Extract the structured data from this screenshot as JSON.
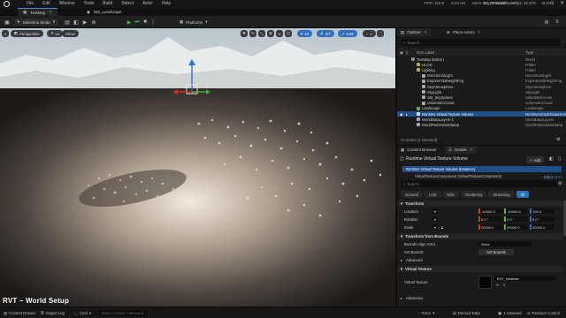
{
  "titlebar": {
    "menu": [
      "File",
      "Edit",
      "Window",
      "Tools",
      "Build",
      "Select",
      "Actor",
      "Help"
    ],
    "stats": [
      "FPS: 119.9",
      "8.34 ms",
      "Mem: 3,548.80 MB",
      "Objs: 42,878",
      "0 Errs"
    ],
    "project": "SC_TerrainShader"
  },
  "tabs": [
    {
      "label": "TestMap"
    },
    {
      "label": "NM_Landscape"
    }
  ],
  "toolbar": {
    "mode": "Selection Mode",
    "platforms": "Platforms"
  },
  "viewport": {
    "perspective": "Perspective",
    "lit": "Lit",
    "show": "Show",
    "snap_grid": "10",
    "snap_rotate": "10°",
    "snap_scale": "0.25",
    "camera_speed": "1"
  },
  "outliner": {
    "tab": "Outliner",
    "tab2": "Place Actors",
    "search_placeholder": "Search...",
    "col_label": "Item Label",
    "col_type": "Type",
    "rows": [
      {
        "label": "TestMap (Editor)",
        "type": "World"
      },
      {
        "label": "HLOD",
        "type": "Folder"
      },
      {
        "label": "Lighting",
        "type": "Folder"
      },
      {
        "label": "DirectionalLight",
        "type": "DirectionalLight"
      },
      {
        "label": "ExponentialHeightFog",
        "type": "ExponentialHeightFog"
      },
      {
        "label": "SkyAtmosphere",
        "type": "SkyAtmosphere"
      },
      {
        "label": "SkyLight",
        "type": "SkyLight"
      },
      {
        "label": "SM_SkySphere",
        "type": "StaticMeshActor"
      },
      {
        "label": "VolumetricCloud",
        "type": "VolumetricCloud"
      },
      {
        "label": "Landscape",
        "type": "Landscape"
      },
      {
        "label": "Runtime Virtual Texture Volume",
        "type": "RuntimeVirtualTextureVolume"
      },
      {
        "label": "WorldDataLayers-1",
        "type": "WorldDataLayers"
      },
      {
        "label": "WorldPartitionMiniMap",
        "type": "WorldPartitionMiniMap"
      }
    ],
    "count": "74 actors (1 selected)"
  },
  "details": {
    "tab_content": "Content Browser",
    "tab_details": "Details",
    "title": "Runtime Virtual Texture Volume",
    "add_label": "Add",
    "component_root": "Runtime Virtual Texture Volume (Instance)",
    "component_child": "VirtualTextureComponent (VirtualTextureComponent)",
    "edit_in_cpp": "Edit in C++",
    "search_placeholder": "Search",
    "filters": [
      "General",
      "LOD",
      "Misc",
      "Rendering",
      "Streaming",
      "All"
    ],
    "transform_header": "Transform",
    "location_label": "Location",
    "location": [
      "-10000.0",
      "-10000.0",
      "100.0"
    ],
    "rotation_label": "Rotation",
    "rotation": [
      "0.0 °",
      "0.0 °",
      "0.0 °"
    ],
    "scale_label": "Scale",
    "scale": [
      "20000.0",
      "20000.0",
      "20000.0"
    ],
    "bounds_header": "Transform from Bounds",
    "bounds_align_label": "Bounds Align Actor",
    "bounds_align_value": "None",
    "set_bounds_label": "Set Bounds",
    "set_bounds_button": "Set Bounds",
    "advanced_label": "Advanced",
    "vt_header": "Virtual Texture",
    "vt_label": "Virtual Texture",
    "vt_value": "RVT_Material",
    "advanced2_label": "Advanced"
  },
  "statusbar": {
    "content_drawer": "Content Drawer",
    "output_log": "Output Log",
    "cmd": "Cmd",
    "cmd_placeholder": "Enter Console Command",
    "trace": "Trace",
    "derived_data": "Derived Data",
    "unsaved": "1 Unsaved",
    "revision": "Revision Control"
  },
  "watermark": "RVT – World Setup",
  "colors": {
    "accent": "#2f6fba",
    "selection": "#1e4f8a",
    "panel": "#1a1a1a"
  }
}
